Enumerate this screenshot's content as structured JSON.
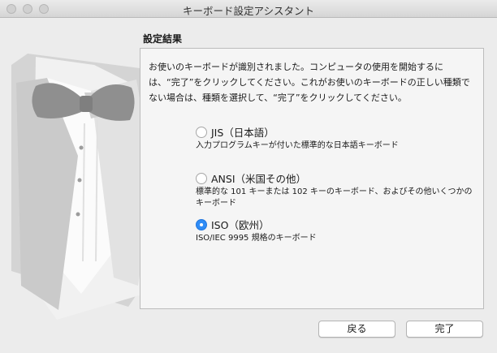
{
  "window": {
    "title": "キーボード設定アシスタント"
  },
  "section_title": "設定結果",
  "description": "お使いのキーボードが識別されました。コンピュータの使用を開始するには、“完了”をクリックしてください。これがお使いのキーボードの正しい種類でない場合は、種類を選択して、“完了”をクリックしてください。",
  "options": [
    {
      "label": "JIS（日本語）",
      "description": "入力プログラムキーが付いた標準的な日本語キーボード",
      "selected": false
    },
    {
      "label": "ANSI（米国その他）",
      "description": "標準的な 101 キーまたは 102 キーのキーボード、およびその他いくつかのキーボード",
      "selected": false
    },
    {
      "label": "ISO（欧州）",
      "description": "ISO/IEC 9995 規格のキーボード",
      "selected": true
    }
  ],
  "buttons": {
    "back": "戻る",
    "done": "完了"
  },
  "colors": {
    "accent": "#2f8cf6"
  }
}
